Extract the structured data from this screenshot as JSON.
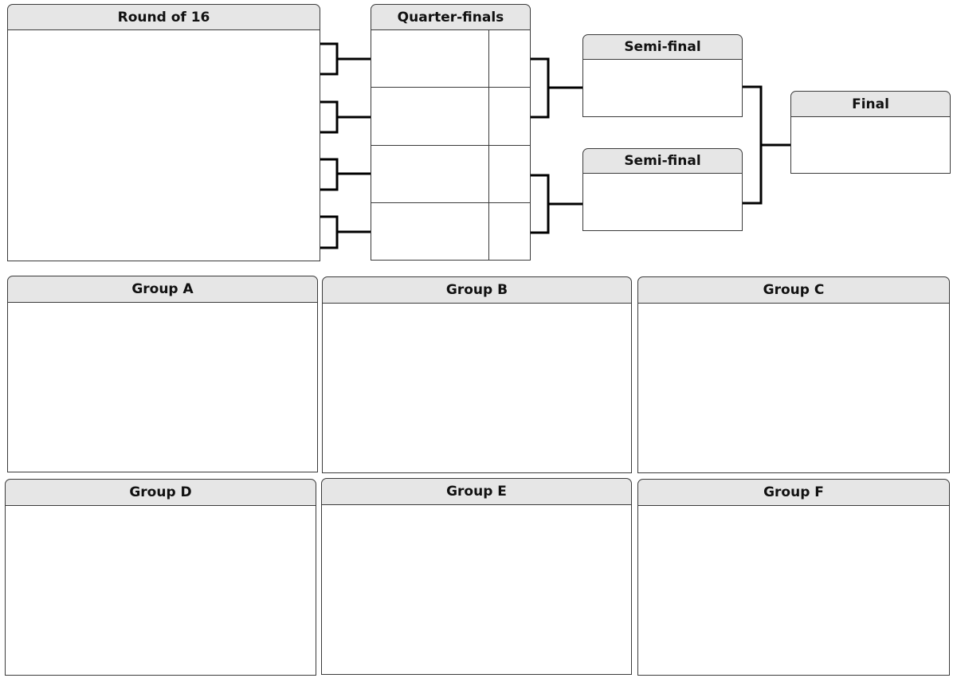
{
  "bracket": {
    "round_of_16": "Round of 16",
    "quarter_finals": "Quarter-finals",
    "semi_final_top": "Semi-final",
    "semi_final_bottom": "Semi-final",
    "final": "Final"
  },
  "groups": {
    "a": "Group A",
    "b": "Group B",
    "c": "Group C",
    "d": "Group D",
    "e": "Group E",
    "f": "Group F"
  },
  "colors": {
    "header_fill": "#e6e6e6",
    "border": "#3a3a3a",
    "connector": "#000000"
  }
}
